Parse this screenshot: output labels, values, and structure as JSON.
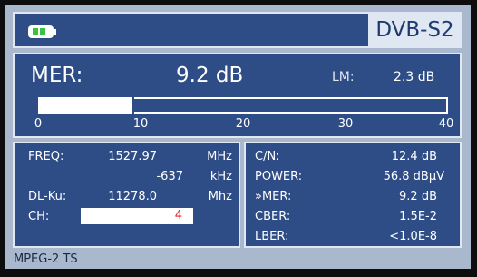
{
  "header": {
    "mode": "DVB-S2"
  },
  "mer": {
    "label": "MER:",
    "value": "9.2 dB",
    "lm_label": "LM:",
    "lm_value": "2.3 dB",
    "bar_level": 9.2,
    "scale": [
      "0",
      "10",
      "20",
      "30",
      "40"
    ]
  },
  "tuning": {
    "freq_label": "FREQ:",
    "freq_value": "1527.97",
    "freq_unit": "MHz",
    "offset_value": "-637",
    "offset_unit": "kHz",
    "dl_label": "DL-Ku:",
    "dl_value": "11278.0",
    "dl_unit": "Mhz",
    "ch_label": "CH:",
    "ch_value": "4"
  },
  "measurements": [
    {
      "label": "C/N:",
      "value": "12.4 dB"
    },
    {
      "label": "POWER:",
      "value": "56.8 dBµV"
    },
    {
      "label": "»MER:",
      "value": "9.2 dB"
    },
    {
      "label": "CBER:",
      "value": "1.5E-2"
    },
    {
      "label": "LBER:",
      "value": "<1.0E-8"
    }
  ],
  "footer": {
    "text": "MPEG-2 TS"
  },
  "colors": {
    "panel": "#2e4d86",
    "background": "#a9b8cc",
    "battery": "#3cc241",
    "ch_value": "#e0202a"
  },
  "icons": {
    "battery": "battery-icon"
  }
}
